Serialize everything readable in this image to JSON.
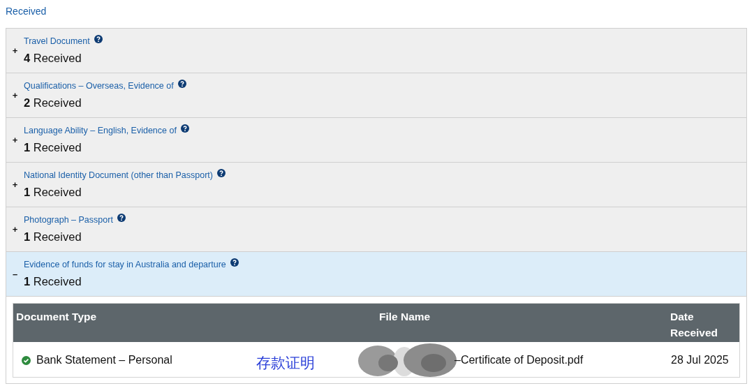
{
  "heading": "Received",
  "sections": [
    {
      "toggle": "+",
      "label": "Travel Document",
      "count": "**4** Received",
      "expanded": false
    },
    {
      "toggle": "+",
      "label": "Qualifications – Overseas, Evidence of",
      "count": "**2** Received",
      "expanded": false
    },
    {
      "toggle": "+",
      "label": "Language Ability – English, Evidence of",
      "count": "**1** Received",
      "expanded": false
    },
    {
      "toggle": "+",
      "label": "National Identity Document (other than Passport)",
      "count": "**1** Received",
      "expanded": false
    },
    {
      "toggle": "+",
      "label": "Photograph – Passport",
      "count": "**1** Received",
      "expanded": false
    },
    {
      "toggle": "–",
      "label": "Evidence of funds for stay in Australia and departure",
      "count": "**1** Received",
      "expanded": true,
      "table": {
        "columns": [
          "Document Type",
          "File Name",
          "Date Received"
        ],
        "rows": [
          {
            "document_type": "Bank Statement – Personal",
            "file_name": "–Certificate of Deposit.pdf",
            "date_received": "28 Jul 2025",
            "received": true
          }
        ]
      }
    }
  ],
  "annotation": {
    "text": "存款证明"
  }
}
